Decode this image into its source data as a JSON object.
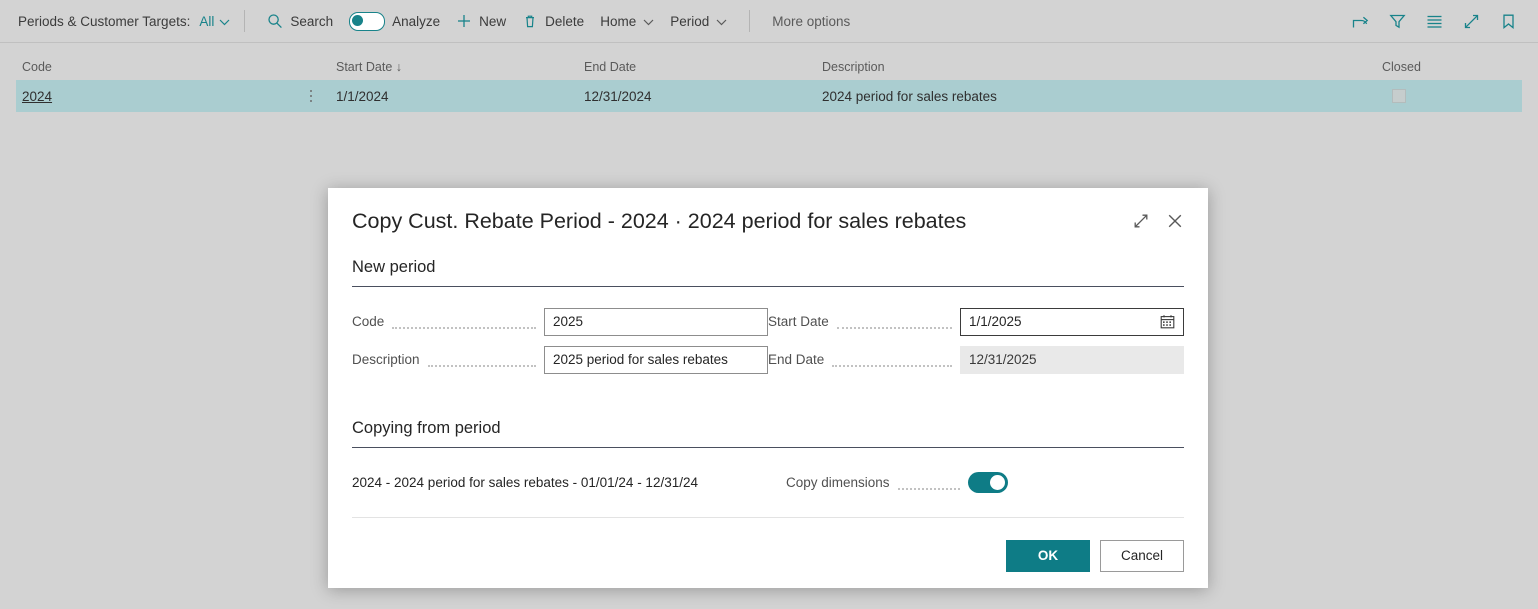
{
  "toolbar": {
    "page_caption": "Periods & Customer Targets:",
    "view_label": "All",
    "search_label": "Search",
    "analyze_label": "Analyze",
    "new_label": "New",
    "delete_label": "Delete",
    "home_label": "Home",
    "period_label": "Period",
    "more_options_label": "More options",
    "analyze_toggle_state": "off",
    "icons": {
      "search": "search-icon",
      "new": "plus-icon",
      "delete": "trash-icon",
      "share": "share-icon",
      "filter": "filter-icon",
      "list": "list-icon",
      "expand": "expand-icon",
      "bookmark": "bookmark-icon"
    }
  },
  "grid": {
    "columns": [
      "Code",
      "Start Date ↓",
      "End Date",
      "Description",
      "Closed"
    ],
    "rows": [
      {
        "code": "2024",
        "start_date": "1/1/2024",
        "end_date": "12/31/2024",
        "description": "2024 period for sales rebates",
        "closed": false,
        "selected": true
      }
    ]
  },
  "dialog": {
    "title": "Copy Cust. Rebate Period - 2024 · 2024 period for sales rebates",
    "sections": {
      "new_period": {
        "heading": "New period",
        "fields": [
          {
            "label": "Code",
            "value": "2025",
            "state": "editable"
          },
          {
            "label": "Start Date",
            "value": "1/1/2025",
            "state": "focused"
          },
          {
            "label": "Description",
            "value": "2025 period for sales rebates",
            "state": "editable"
          },
          {
            "label": "End Date",
            "value": "12/31/2025",
            "state": "readonly"
          }
        ]
      },
      "copying_from": {
        "heading": "Copying from period",
        "source_text": "2024 - 2024 period for sales rebates - 01/01/24 - 12/31/24",
        "copy_dimensions_label": "Copy dimensions",
        "copy_dimensions_state": "on"
      }
    },
    "buttons": {
      "ok": "OK",
      "cancel": "Cancel"
    },
    "icons": {
      "expand": "expand-icon",
      "close": "close-icon",
      "calendar": "calendar-icon"
    }
  },
  "colors": {
    "accent": "#0e7c86",
    "toolbar_icon": "#18838a",
    "selected_row": "#aacdd0",
    "page_background": "#d3d3d3"
  }
}
